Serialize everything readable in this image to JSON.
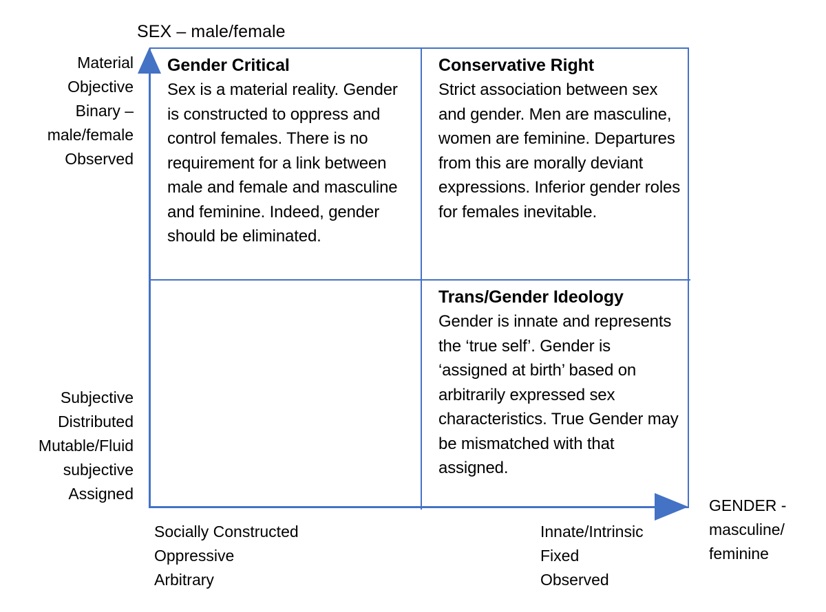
{
  "diagram": {
    "title_top": "SEX – male/female",
    "title_right": "GENDER -\nmasculine/\nfeminine",
    "accent_color": "#4472C4",
    "border_color": "#4472C4",
    "background_color": "#ffffff",
    "text_color": "#000000"
  },
  "y_axis": {
    "name": "SEX – male/female",
    "top_label": "Material\nObjective\nBinary –\nmale/female\nObserved",
    "bottom_label": "Subjective\nDistributed\nMutable/Fluid\nsubjective\nAssigned"
  },
  "x_axis": {
    "name": "GENDER - masculine/feminine",
    "left_label": "Socially Constructed\nOppressive\nArbitrary",
    "right_label": "Innate/Intrinsic\nFixed\nObserved",
    "axis_title": "GENDER -\nmasculine/\nfeminine"
  },
  "quadrants": {
    "top_left": {
      "title": "Gender Critical",
      "body": "Sex is a material reality. Gender is constructed to oppress and control females. There is no requirement for a link between male and female and masculine and feminine. Indeed, gender should be eliminated."
    },
    "top_right": {
      "title": "Conservative Right",
      "body": "Strict association between sex and gender. Men are masculine, women are feminine. Departures from this are morally deviant expressions. Inferior gender roles for females inevitable."
    },
    "bottom_left": {
      "title": "",
      "body": ""
    },
    "bottom_right": {
      "title": "Trans/Gender Ideology",
      "body": "Gender is innate and represents the ‘true self’. Gender is ‘assigned at birth’ based on arbitrarily expressed sex characteristics. True Gender may be mismatched with that assigned."
    }
  },
  "icons": {
    "up_arrow": "arrow-up-icon",
    "right_arrow": "arrow-right-icon"
  }
}
